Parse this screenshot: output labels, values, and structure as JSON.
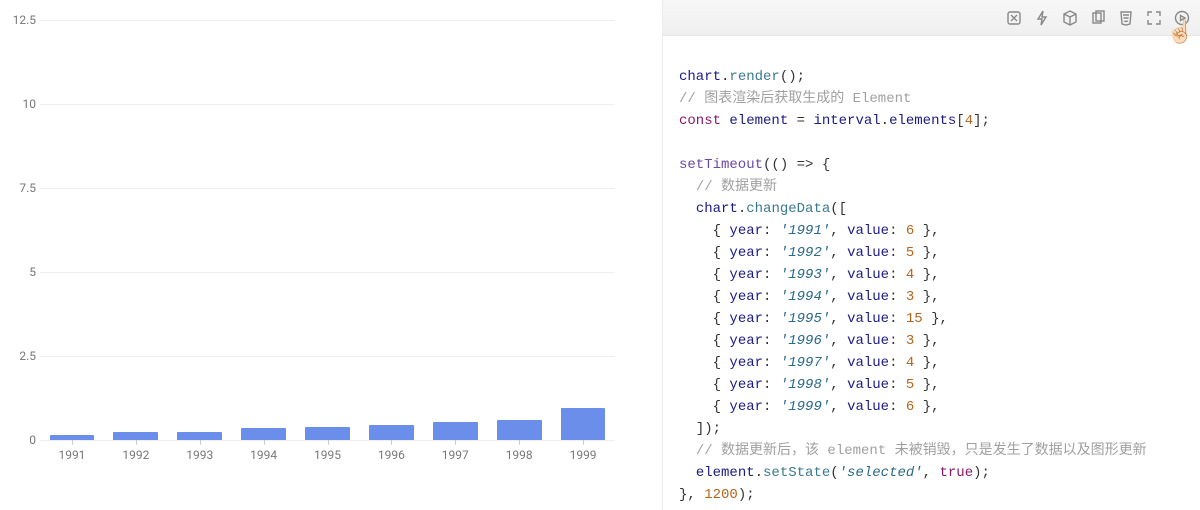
{
  "chart_data": {
    "type": "bar",
    "categories": [
      "1991",
      "1992",
      "1993",
      "1994",
      "1995",
      "1996",
      "1997",
      "1998",
      "1999"
    ],
    "values": [
      0.15,
      0.25,
      0.25,
      0.35,
      0.4,
      0.45,
      0.55,
      0.6,
      0.95
    ],
    "xlabel": "",
    "ylabel": "",
    "ylim": [
      0,
      12.5
    ],
    "yticks": [
      0,
      2.5,
      5,
      7.5,
      10,
      12.5
    ],
    "color": "#6a8eea"
  },
  "toolbar": {
    "icons": [
      "riddle-icon",
      "lightning-icon",
      "cube-icon",
      "copy-icon",
      "html5-icon",
      "expand-icon",
      "play-icon"
    ]
  },
  "code": {
    "line1_ident": "chart",
    "line1_method": "render",
    "line2_comment": "// 图表渲染后获取生成的 Element",
    "line3_kw_const": "const",
    "line3_var": "element",
    "line3_rhs_ident": "interval",
    "line3_rhs_prop": "elements",
    "line3_rhs_index": "4",
    "line5_func": "setTimeout",
    "line6_comment": "// 数据更新",
    "line7_ident": "chart",
    "line7_method": "changeData",
    "rows": [
      {
        "year": "'1991'",
        "value": "6"
      },
      {
        "year": "'1992'",
        "value": "5"
      },
      {
        "year": "'1993'",
        "value": "4"
      },
      {
        "year": "'1994'",
        "value": "3"
      },
      {
        "year": "'1995'",
        "value": "15"
      },
      {
        "year": "'1996'",
        "value": "3"
      },
      {
        "year": "'1997'",
        "value": "4"
      },
      {
        "year": "'1998'",
        "value": "5"
      },
      {
        "year": "'1999'",
        "value": "6"
      }
    ],
    "row_key_year": "year",
    "row_key_value": "value",
    "line18_comment": "// 数据更新后，该 element 未被销毁，只是发生了数据以及图形更新",
    "line19_ident": "element",
    "line19_method": "setState",
    "line19_arg1": "'selected'",
    "line19_arg2": "true",
    "line20_delay": "1200"
  }
}
